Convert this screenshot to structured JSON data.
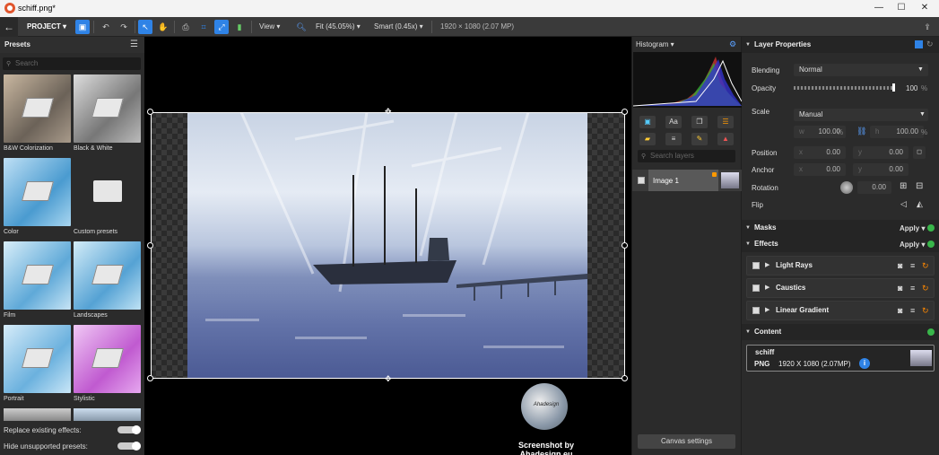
{
  "window": {
    "title": "schiff.png*",
    "minimize": "—",
    "maximize": "☐",
    "close": "✕"
  },
  "toolbar": {
    "project": "PROJECT ▾",
    "view": "View ▾",
    "fit": "Fit (45.05%) ▾",
    "smart": "Smart (0.45x) ▾",
    "dimensions": "1920 × 1080 (2.07 MP)"
  },
  "presets": {
    "title": "Presets",
    "search_placeholder": "Search",
    "items": [
      {
        "label": "B&W Colorization"
      },
      {
        "label": "Black & White"
      },
      {
        "label": "Color"
      },
      {
        "label": "Custom presets"
      },
      {
        "label": "Film"
      },
      {
        "label": "Landscapes"
      },
      {
        "label": "Portrait"
      },
      {
        "label": "Stylistic"
      }
    ],
    "replace_label": "Replace existing effects:",
    "hide_label": "Hide unsupported presets:"
  },
  "histogram": {
    "label": "Histogram ▾"
  },
  "layers": {
    "search_placeholder": "Search layers",
    "items": [
      {
        "name": "Image 1"
      }
    ],
    "canvas_settings": "Canvas settings"
  },
  "props": {
    "title": "Layer Properties",
    "blending_label": "Blending",
    "blending_value": "Normal",
    "opacity_label": "Opacity",
    "opacity_value": "100",
    "opacity_unit": "%",
    "scale_label": "Scale",
    "scale_value": "Manual",
    "w_label": "w",
    "w_value": "100.00",
    "h_label": "h",
    "h_value": "100.00",
    "percent": "%",
    "position_label": "Position",
    "pos_x_label": "x",
    "pos_x": "0.00",
    "pos_y_label": "y",
    "pos_y": "0.00",
    "anchor_label": "Anchor",
    "anc_x_label": "x",
    "anc_x": "0.00",
    "anc_y_label": "y",
    "anc_y": "0.00",
    "rotation_label": "Rotation",
    "rotation_value": "0.00",
    "flip_label": "Flip"
  },
  "masks": {
    "label": "Masks",
    "apply": "Apply ▾"
  },
  "effects": {
    "label": "Effects",
    "apply": "Apply ▾",
    "items": [
      {
        "name": "Light Rays"
      },
      {
        "name": "Caustics"
      },
      {
        "name": "Linear Gradient"
      }
    ]
  },
  "content": {
    "label": "Content",
    "file_name": "schiff",
    "format": "PNG",
    "size": "1920 X 1080 (2.07MP)",
    "info": "i"
  },
  "watermark": {
    "text": "Screenshot by Ahadesign.eu",
    "center": "Ahadesign"
  },
  "colors": {
    "accent": "#2f83e6",
    "green": "#39b54a",
    "panel": "#2b2b2b"
  }
}
